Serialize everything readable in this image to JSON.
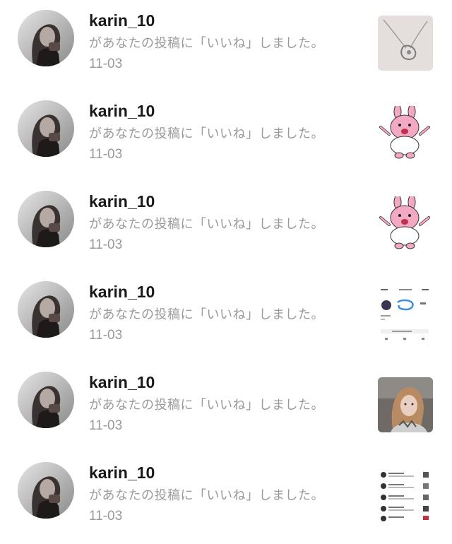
{
  "notifications": [
    {
      "username": "karin_10",
      "action": "があなたの投稿に「いいね」しました。",
      "date": "11-03",
      "thumbnail": "necklace-photo",
      "avatar": "karin-avatar"
    },
    {
      "username": "karin_10",
      "action": "があなたの投稿に「いいね」しました。",
      "date": "11-03",
      "thumbnail": "pink-rabbit-sticker",
      "avatar": "karin-avatar"
    },
    {
      "username": "karin_10",
      "action": "があなたの投稿に「いいね」しました。",
      "date": "11-03",
      "thumbnail": "pink-rabbit-sticker",
      "avatar": "karin-avatar"
    },
    {
      "username": "karin_10",
      "action": "があなたの投稿に「いいね」しました。",
      "date": "11-03",
      "thumbnail": "profile-screenshot",
      "avatar": "karin-avatar"
    },
    {
      "username": "karin_10",
      "action": "があなたの投稿に「いいね」しました。",
      "date": "11-03",
      "thumbnail": "selfie-photo",
      "avatar": "karin-avatar"
    },
    {
      "username": "karin_10",
      "action": "があなたの投稿に「いいね」しました。",
      "date": "11-03",
      "thumbnail": "list-screenshot",
      "avatar": "karin-avatar"
    }
  ]
}
